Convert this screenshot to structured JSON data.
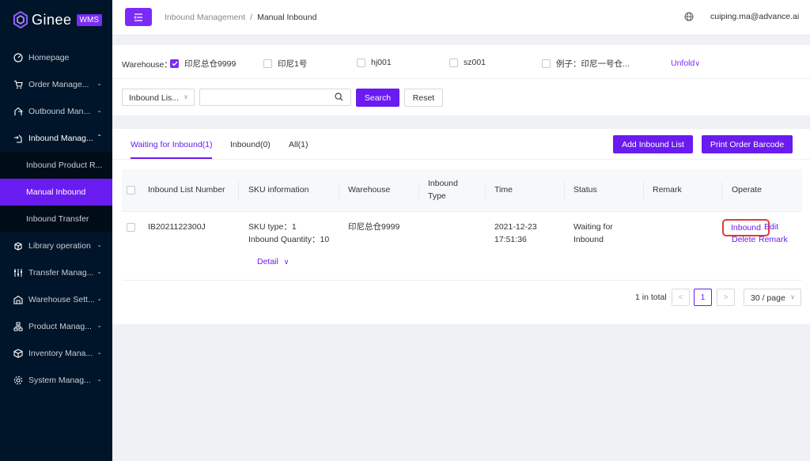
{
  "app": {
    "name": "Ginee",
    "badge": "WMS"
  },
  "sidebar": {
    "items": [
      {
        "label": "Homepage",
        "icon": "dashboard-icon",
        "arrow": ""
      },
      {
        "label": "Order Manage...",
        "icon": "cart-icon",
        "arrow": "⌄"
      },
      {
        "label": "Outbound Man...",
        "icon": "outbound-icon",
        "arrow": "⌄"
      },
      {
        "label": "Inbound Manag...",
        "icon": "inbound-icon",
        "arrow": "⌃"
      }
    ],
    "submenu": [
      {
        "label": "Inbound Product R..."
      },
      {
        "label": "Manual Inbound"
      },
      {
        "label": "Inbound Transfer"
      }
    ],
    "items2": [
      {
        "label": "Library operation",
        "icon": "library-icon",
        "arrow": "⌄"
      },
      {
        "label": "Transfer Manag...",
        "icon": "transfer-icon",
        "arrow": "⌄"
      },
      {
        "label": "Warehouse Sett...",
        "icon": "warehouse-icon",
        "arrow": "⌄"
      },
      {
        "label": "Product Manag...",
        "icon": "product-icon",
        "arrow": "⌄"
      },
      {
        "label": "Inventory Mana...",
        "icon": "inventory-icon",
        "arrow": "⌄"
      },
      {
        "label": "System Manag...",
        "icon": "settings-icon",
        "arrow": "⌄"
      }
    ]
  },
  "header": {
    "breadcrumb": [
      "Inbound Management",
      "Manual Inbound"
    ],
    "separator": "/",
    "user": "cuiping.ma@advance.ai"
  },
  "filters": {
    "warehouse_label": "Warehouse：",
    "warehouses": [
      {
        "label": "印尼总仓9999",
        "checked": true
      },
      {
        "label": "印尼1号",
        "checked": false
      },
      {
        "label": "hj001",
        "checked": false
      },
      {
        "label": "sz001",
        "checked": false
      },
      {
        "label": "例子：印尼一号仓...",
        "checked": false
      }
    ],
    "unfold": "Unfold",
    "select_value": "Inbound Lis...",
    "search_value": "",
    "search_btn": "Search",
    "reset_btn": "Reset"
  },
  "tabs": [
    {
      "label": "Waiting for Inbound(1)"
    },
    {
      "label": "Inbound(0)"
    },
    {
      "label": "All(1)"
    }
  ],
  "actions": {
    "add": "Add Inbound List",
    "print": "Print Order Barcode"
  },
  "table": {
    "columns": [
      "Inbound List Number",
      "SKU information",
      "Warehouse",
      "Inbound",
      "Type",
      "Time",
      "Status",
      "Remark",
      "Operate"
    ],
    "rows": [
      {
        "number": "IB2021122300J",
        "sku_type": "SKU type：1",
        "sku_qty": "Inbound Quantity：10",
        "detail": "Detail",
        "warehouse": "印尼总仓9999",
        "type": "",
        "time_date": "2021-12-23",
        "time_clock": "17:51:36",
        "status_1": "Waiting for",
        "status_2": "Inbound",
        "remark": "",
        "ops": {
          "inbound": "Inbound",
          "edit": "Edit",
          "delete": "Delete",
          "remark": "Remark"
        }
      }
    ]
  },
  "pagination": {
    "total": "1 in total",
    "prev": "<",
    "page": "1",
    "next": ">",
    "size": "30 / page"
  },
  "colors": {
    "accent": "#6a1bf0",
    "sidebar_bg": "#001529",
    "highlight": "#e53935"
  }
}
